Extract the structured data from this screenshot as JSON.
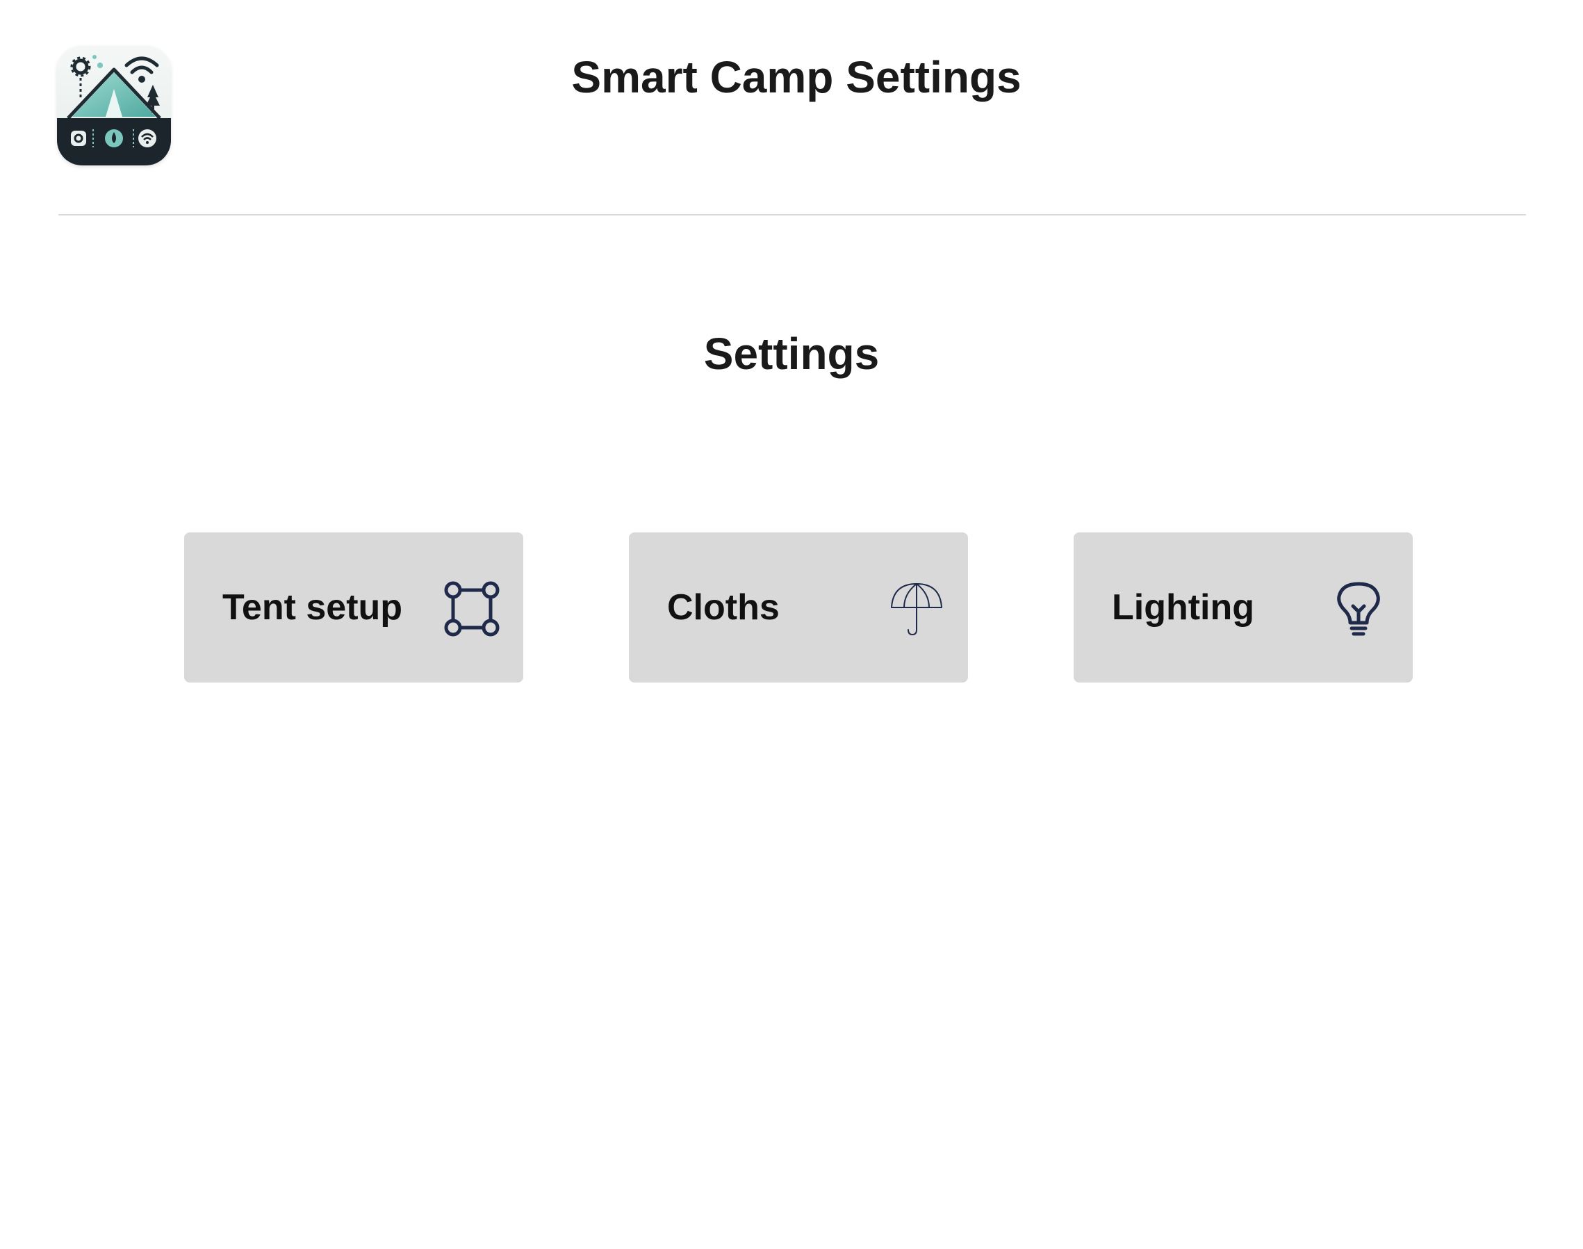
{
  "header": {
    "app_icon": "camp-tent-app-icon",
    "title": "Smart Camp Settings"
  },
  "main": {
    "section_title": "Settings",
    "cards": [
      {
        "label": "Tent setup",
        "icon": "tent-frame-icon"
      },
      {
        "label": "Cloths",
        "icon": "umbrella-icon"
      },
      {
        "label": "Lighting",
        "icon": "lightbulb-icon"
      }
    ]
  },
  "colors": {
    "card_background": "#d9d9d9",
    "icon_stroke": "#1f2a4a",
    "divider": "#d9d9d9",
    "text": "#1a1a1a"
  }
}
